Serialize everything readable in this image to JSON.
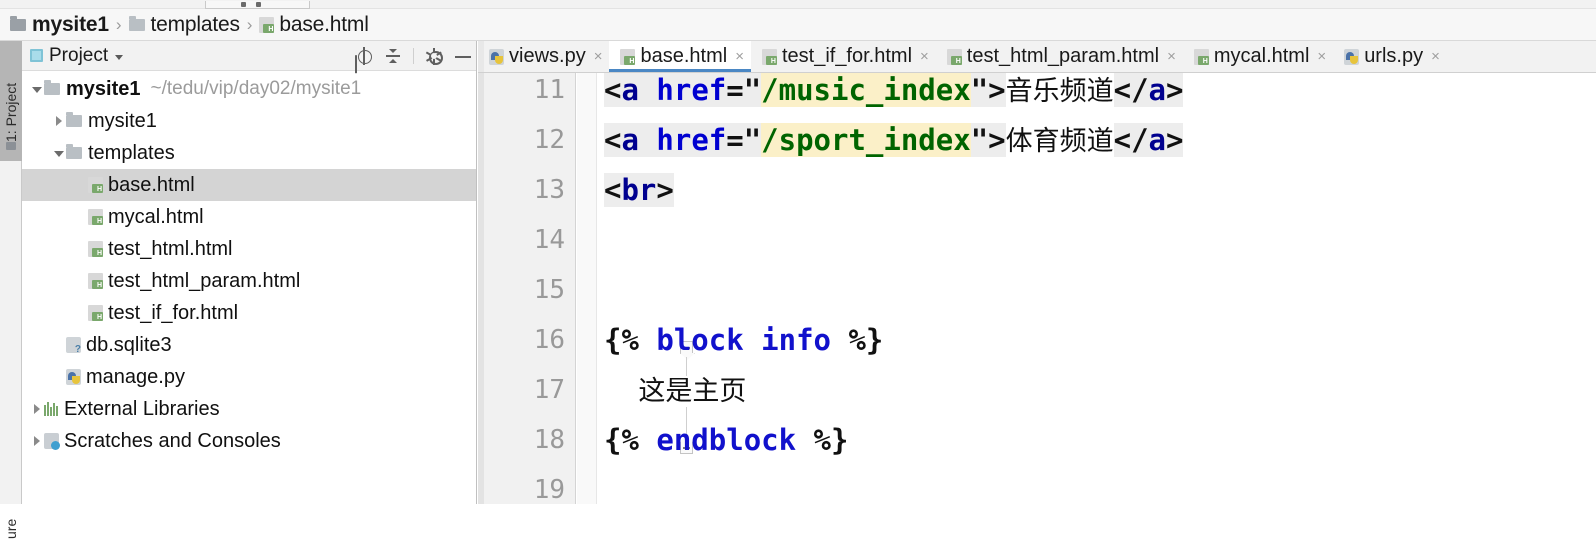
{
  "breadcrumb": {
    "items": [
      {
        "label": "mysite1",
        "icon": "folder-icon",
        "bold": true
      },
      {
        "label": "templates",
        "icon": "folder-icon",
        "bold": false
      },
      {
        "label": "base.html",
        "icon": "html-file-icon",
        "bold": false
      }
    ],
    "separator": "›"
  },
  "left_strip": {
    "tabs": [
      {
        "label": "1: Project",
        "active": true
      },
      {
        "label": "ure",
        "active": false
      }
    ]
  },
  "project_panel": {
    "title": "Project",
    "caret": "▾",
    "actions": [
      {
        "name": "locate-icon",
        "title": "Select Opened File"
      },
      {
        "name": "collapse-all-icon",
        "title": "Collapse All"
      },
      {
        "name": "gear-icon",
        "title": "Settings"
      },
      {
        "name": "minimize-icon",
        "title": "Hide"
      }
    ],
    "tree": [
      {
        "label": "mysite1",
        "path": "~/tedu/vip/day02/mysite1",
        "icon": "folder-icon",
        "twisty": "open",
        "indent": 0,
        "bold": true,
        "selected": false
      },
      {
        "label": "mysite1",
        "path": "",
        "icon": "folder-icon",
        "twisty": "closed",
        "indent": 1,
        "bold": false,
        "selected": false
      },
      {
        "label": "templates",
        "path": "",
        "icon": "folder-icon",
        "twisty": "open",
        "indent": 1,
        "bold": false,
        "selected": false
      },
      {
        "label": "base.html",
        "path": "",
        "icon": "html-file-icon",
        "twisty": "none",
        "indent": 2,
        "bold": false,
        "selected": true
      },
      {
        "label": "mycal.html",
        "path": "",
        "icon": "html-file-icon",
        "twisty": "none",
        "indent": 2,
        "bold": false,
        "selected": false
      },
      {
        "label": "test_html.html",
        "path": "",
        "icon": "html-file-icon",
        "twisty": "none",
        "indent": 2,
        "bold": false,
        "selected": false
      },
      {
        "label": "test_html_param.html",
        "path": "",
        "icon": "html-file-icon",
        "twisty": "none",
        "indent": 2,
        "bold": false,
        "selected": false
      },
      {
        "label": "test_if_for.html",
        "path": "",
        "icon": "html-file-icon",
        "twisty": "none",
        "indent": 2,
        "bold": false,
        "selected": false
      },
      {
        "label": "db.sqlite3",
        "path": "",
        "icon": "database-file-icon",
        "twisty": "none",
        "indent": 1,
        "bold": false,
        "selected": false
      },
      {
        "label": "manage.py",
        "path": "",
        "icon": "python-file-icon",
        "twisty": "none",
        "indent": 1,
        "bold": false,
        "selected": false
      },
      {
        "label": "External Libraries",
        "path": "",
        "icon": "library-icon",
        "twisty": "closed",
        "indent": 0,
        "bold": false,
        "selected": false
      },
      {
        "label": "Scratches and Consoles",
        "path": "",
        "icon": "scratch-icon",
        "twisty": "closed",
        "indent": 0,
        "bold": false,
        "selected": false
      }
    ]
  },
  "editor": {
    "tabs": [
      {
        "label": "views.py",
        "icon": "python-file-icon",
        "active": false,
        "close": "×"
      },
      {
        "label": "base.html",
        "icon": "html-file-icon",
        "active": true,
        "close": "×"
      },
      {
        "label": "test_if_for.html",
        "icon": "html-file-icon",
        "active": false,
        "close": "×"
      },
      {
        "label": "test_html_param.html",
        "icon": "html-file-icon",
        "active": false,
        "close": "×"
      },
      {
        "label": "mycal.html",
        "icon": "html-file-icon",
        "active": false,
        "close": "×"
      },
      {
        "label": "urls.py",
        "icon": "python-file-icon",
        "active": false,
        "close": "×"
      }
    ],
    "line_numbers": [
      "11",
      "12",
      "13",
      "14",
      "15",
      "16",
      "17",
      "18",
      "19"
    ],
    "lines": [
      {
        "num": "11",
        "tokens": [
          {
            "text": "<",
            "type": "punct"
          },
          {
            "text": "a",
            "type": "tag"
          },
          {
            "text": " ",
            "type": "punct"
          },
          {
            "text": "href",
            "type": "attr"
          },
          {
            "text": "=\"",
            "type": "punct"
          },
          {
            "text": "/music_index",
            "type": "str-hl"
          },
          {
            "text": "\"",
            "type": "punct"
          },
          {
            "text": ">",
            "type": "punct"
          },
          {
            "text": "音乐频道",
            "type": "cn"
          },
          {
            "text": "</",
            "type": "punct"
          },
          {
            "text": "a",
            "type": "tag"
          },
          {
            "text": ">",
            "type": "punct"
          }
        ]
      },
      {
        "num": "12",
        "tokens": [
          {
            "text": "<",
            "type": "punct"
          },
          {
            "text": "a",
            "type": "tag"
          },
          {
            "text": " ",
            "type": "punct"
          },
          {
            "text": "href",
            "type": "attr"
          },
          {
            "text": "=\"",
            "type": "punct"
          },
          {
            "text": "/sport_index",
            "type": "str-hl"
          },
          {
            "text": "\"",
            "type": "punct"
          },
          {
            "text": ">",
            "type": "punct"
          },
          {
            "text": "体育频道",
            "type": "cn"
          },
          {
            "text": "</",
            "type": "punct"
          },
          {
            "text": "a",
            "type": "tag"
          },
          {
            "text": ">",
            "type": "punct"
          }
        ]
      },
      {
        "num": "13",
        "tokens": [
          {
            "text": "<",
            "type": "punct"
          },
          {
            "text": "br",
            "type": "tag"
          },
          {
            "text": ">",
            "type": "punct"
          }
        ]
      },
      {
        "num": "14",
        "tokens": []
      },
      {
        "num": "15",
        "tokens": []
      },
      {
        "num": "16",
        "tokens": [
          {
            "text": "{% ",
            "type": "dj"
          },
          {
            "text": "block info",
            "type": "djkw"
          },
          {
            "text": " %}",
            "type": "dj"
          }
        ]
      },
      {
        "num": "17",
        "tokens": [
          {
            "text": "    这是主页",
            "type": "cn"
          }
        ]
      },
      {
        "num": "18",
        "tokens": [
          {
            "text": "{% ",
            "type": "dj"
          },
          {
            "text": "endblock",
            "type": "djkw"
          },
          {
            "text": " %}",
            "type": "dj"
          }
        ]
      },
      {
        "num": "19",
        "tokens": []
      }
    ],
    "fold_markers": [
      {
        "line": "16",
        "kind": "start"
      },
      {
        "line": "18",
        "kind": "end"
      }
    ]
  },
  "colors": {
    "tag": "#00008f",
    "attr": "#0000d0",
    "string": "#006400",
    "highlight": "#fbf0c8",
    "token_bg": "#ededed",
    "selection": "#d4d4d4",
    "active_tab_underline": "#4a87c4",
    "gutter_text": "#999999"
  }
}
